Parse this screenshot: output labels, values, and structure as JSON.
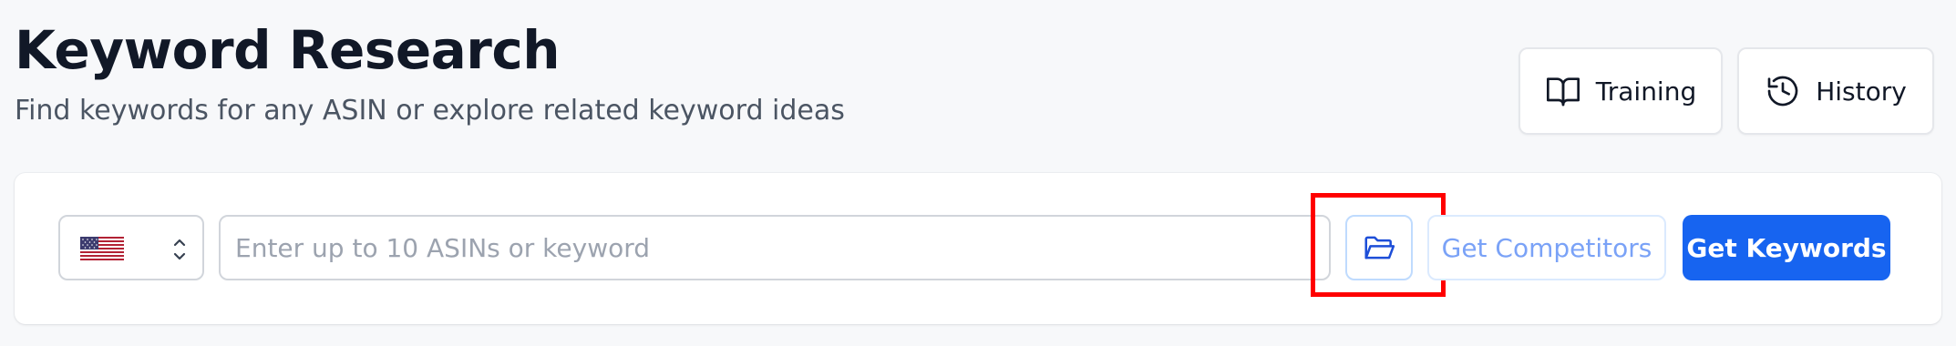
{
  "header": {
    "title": "Keyword Research",
    "subtitle": "Find keywords for any ASIN or explore related keyword ideas",
    "training_label": "Training",
    "history_label": "History"
  },
  "search": {
    "country": "United States",
    "country_flag_icon": "us-flag-icon",
    "placeholder": "Enter up to 10 ASINs or keyword",
    "value": "",
    "folder_icon": "folder-open-icon",
    "competitors_label": "Get Competitors",
    "keywords_label": "Get Keywords"
  },
  "colors": {
    "primary": "#1764f0",
    "highlight": "#ff0000",
    "competitors_text": "#7aa2f7",
    "background": "#f7f8fa"
  }
}
